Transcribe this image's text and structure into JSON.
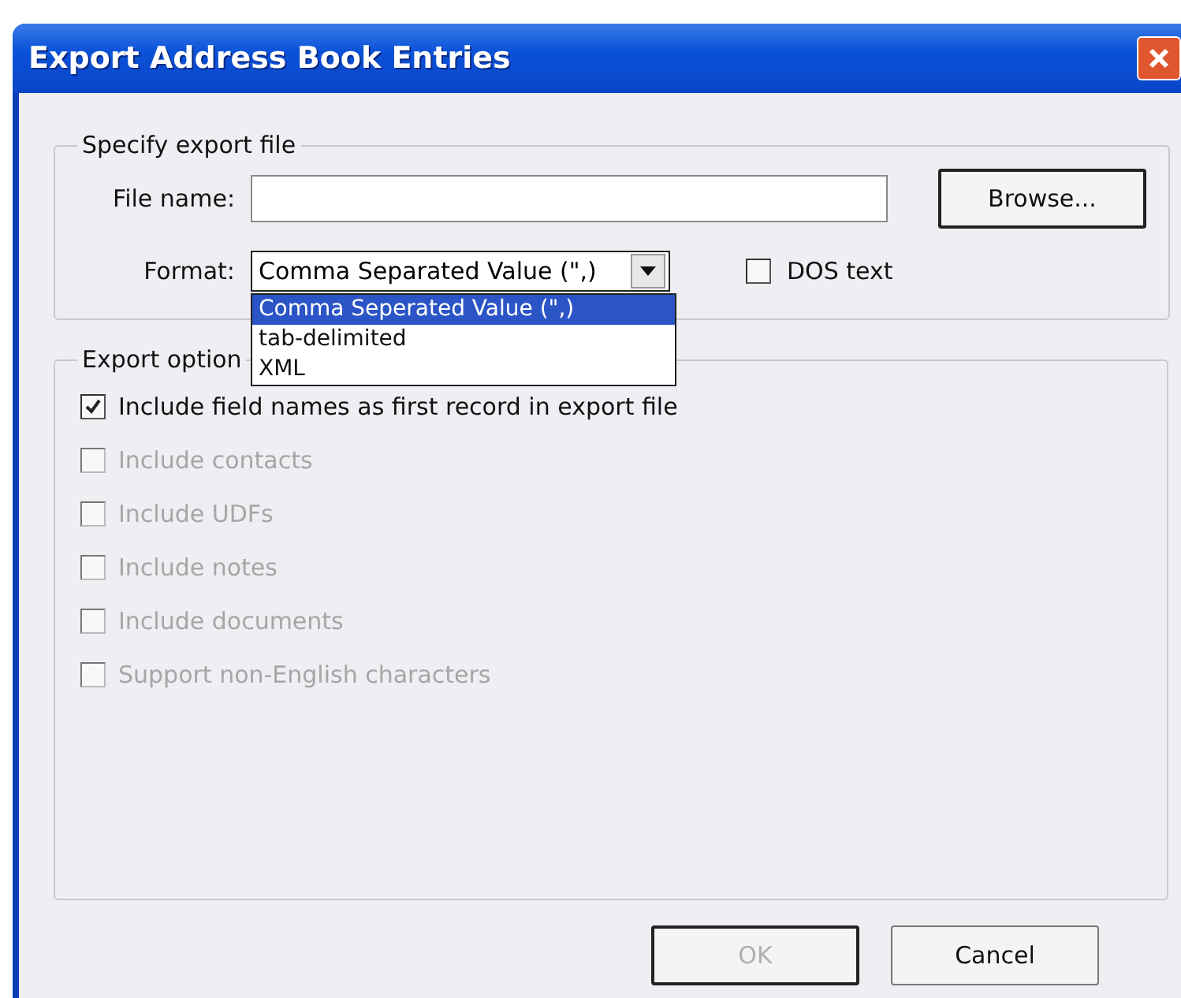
{
  "window": {
    "title": "Export Address Book Entries"
  },
  "export_file": {
    "legend": "Specify export file",
    "file_name": {
      "label": "File name:"
    },
    "format": {
      "label": "Format:",
      "value": "Comma Separated Value (\",)",
      "expanded": true,
      "options": [
        {
          "label": "Comma Seperated Value (\",)",
          "selected": true
        },
        {
          "label": "tab-delimited",
          "selected": false
        },
        {
          "label": "XML",
          "selected": false
        }
      ]
    },
    "browse_button": "Browse...",
    "dos_text": {
      "label": "DOS text",
      "checked": false
    }
  },
  "export_options": {
    "legend": "Export option",
    "items": [
      {
        "label": "Include field names as first record in export file",
        "checked": true,
        "disabled": false
      },
      {
        "label": "Include contacts",
        "checked": false,
        "disabled": true
      },
      {
        "label": "Include UDFs",
        "checked": false,
        "disabled": true
      },
      {
        "label": "Include notes",
        "checked": false,
        "disabled": true
      },
      {
        "label": "Include documents",
        "checked": false,
        "disabled": true
      },
      {
        "label": "Support non-English characters",
        "checked": false,
        "disabled": true
      }
    ]
  },
  "buttons": [
    {
      "label": "OK",
      "disabled": true,
      "default": true
    },
    {
      "label": "Cancel",
      "disabled": false,
      "default": false
    }
  ]
}
